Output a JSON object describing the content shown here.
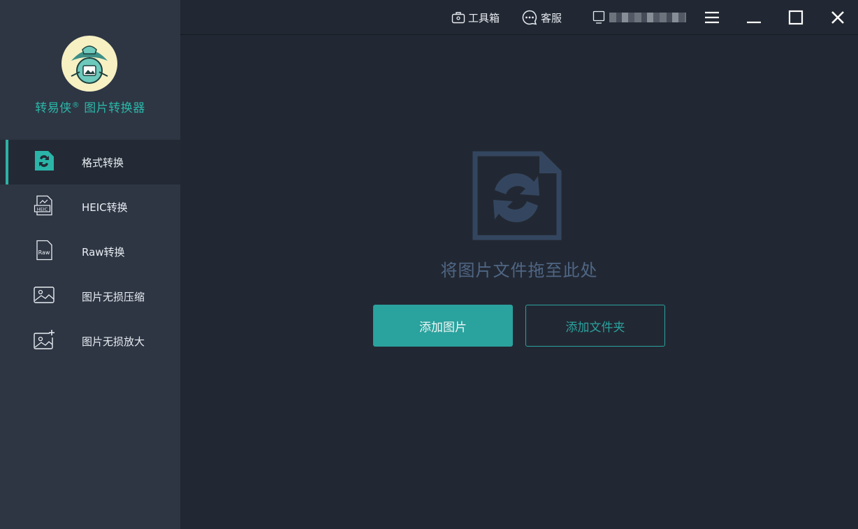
{
  "app": {
    "title": "转易侠",
    "title_mark": "®",
    "subtitle": "图片转换器"
  },
  "sidebar": {
    "items": [
      {
        "label": "格式转换",
        "icon": "format-convert-icon",
        "active": true
      },
      {
        "label": "HEIC转换",
        "icon": "heic-file-icon",
        "badge": "HEIC"
      },
      {
        "label": "Raw转换",
        "icon": "raw-file-icon",
        "badge": "Raw"
      },
      {
        "label": "图片无损压缩",
        "icon": "image-icon"
      },
      {
        "label": "图片无损放大",
        "icon": "image-plus-icon"
      }
    ]
  },
  "topbar": {
    "toolbox_label": "工具箱",
    "support_label": "客服",
    "account_icon": "device-icon"
  },
  "main": {
    "drop_text": "将图片文件拖至此处",
    "add_images_label": "添加图片",
    "add_folder_label": "添加文件夹"
  },
  "colors": {
    "accent": "#2aa29e",
    "sidebar_bg": "#2e3644",
    "main_bg": "#222833",
    "drop_icon": "#34465f"
  }
}
